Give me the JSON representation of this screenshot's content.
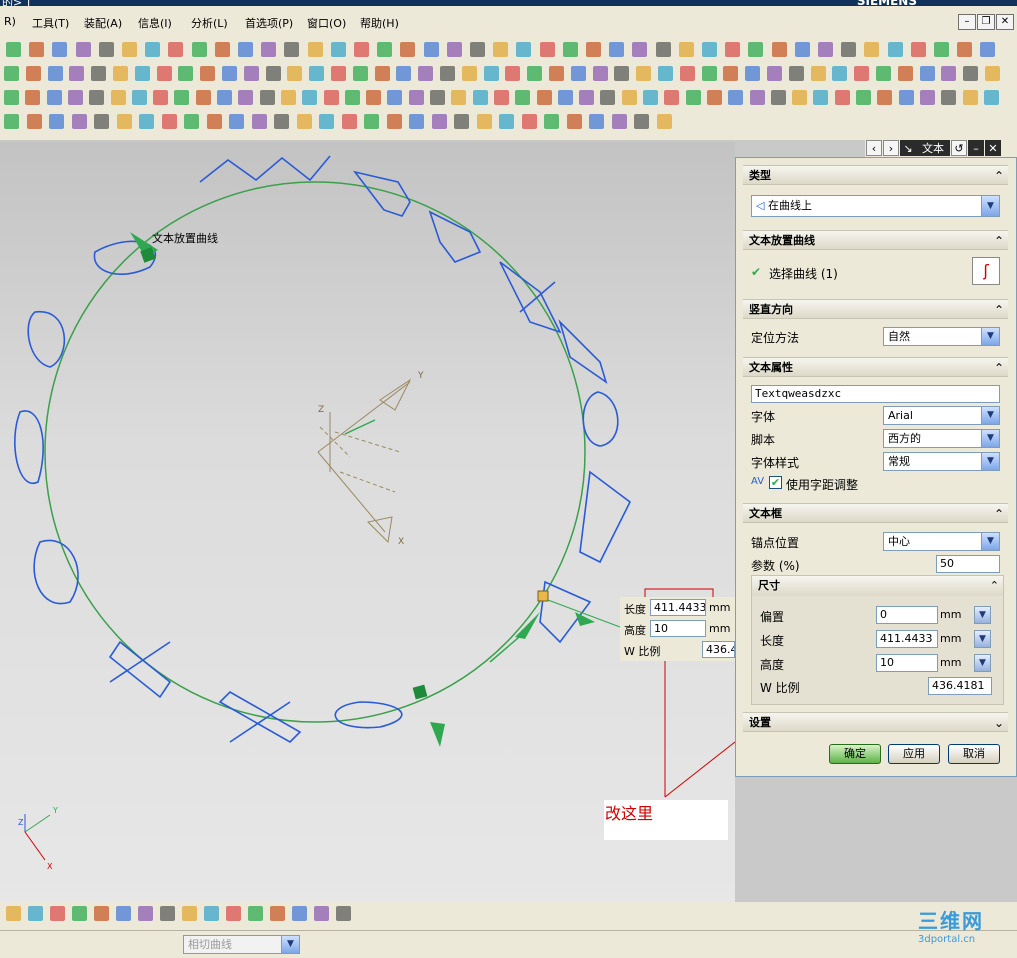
{
  "title_bar": {
    "left_text": "的>  ]",
    "brand": "SIEMENS"
  },
  "menu": {
    "items": [
      "R)",
      "工具(T)",
      "装配(A)",
      "信息(I)",
      "分析(L)",
      "首选项(P)",
      "窗口(O)",
      "帮助(H)"
    ]
  },
  "viewport": {
    "curve_label": "文本放置曲线",
    "floating": {
      "length_label": "长度",
      "length_value": "411.4433",
      "length_unit": "mm",
      "height_label": "高度",
      "height_value": "10",
      "height_unit": "mm",
      "wscale_label": "W 比例",
      "wscale_value": "436.4"
    },
    "annotation_note": "改这里",
    "axis_labels": {
      "x": "X",
      "y": "Y",
      "z": "Z"
    }
  },
  "dialog": {
    "title": "文本",
    "type_section": {
      "header": "类型",
      "value": "在曲线上"
    },
    "curve_section": {
      "header": "文本放置曲线",
      "select_label": "选择曲线 (1)"
    },
    "vertical_section": {
      "header": "竖直方向",
      "method_label": "定位方法",
      "method_value": "自然"
    },
    "props_section": {
      "header": "文本属性",
      "text_value": "Textqweasdzxc",
      "font_label": "字体",
      "font_value": "Arial",
      "script_label": "脚本",
      "script_value": "西方的",
      "style_label": "字体样式",
      "style_value": "常规",
      "kerning_label": "使用字距调整",
      "kerning_checked": true
    },
    "frame_section": {
      "header": "文本框",
      "anchor_label": "锚点位置",
      "anchor_value": "中心",
      "param_label": "参数 (%)",
      "param_value": "50",
      "size_header": "尺寸",
      "offset_label": "偏置",
      "offset_value": "0",
      "offset_unit": "mm",
      "length_label": "长度",
      "length_value": "411.4433",
      "length_unit": "mm",
      "height_label": "高度",
      "height_value": "10",
      "height_unit": "mm",
      "wscale_label": "W 比例",
      "wscale_value": "436.4181"
    },
    "settings_header": "设置",
    "buttons": {
      "ok": "确定",
      "apply": "应用",
      "cancel": "取消"
    }
  },
  "bottom": {
    "filter_placeholder": "相切曲线",
    "watermark_top": "三维网",
    "watermark_bottom": "3dportal.cn"
  },
  "colors": {
    "accent_green": "#2fa84f",
    "curve_text_blue": "#2a5bd7",
    "note_red": "#d00000",
    "toolbar_bg": "#ece9d8"
  }
}
